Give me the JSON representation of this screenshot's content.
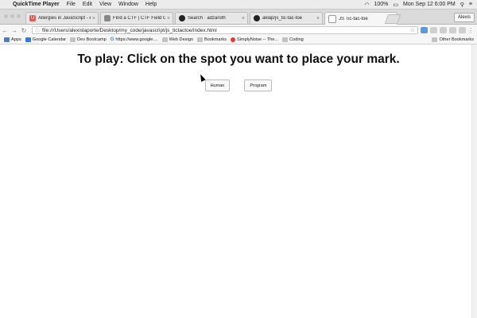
{
  "menubar": {
    "app": "QuickTime Player",
    "items": [
      "File",
      "Edit",
      "View",
      "Window",
      "Help"
    ],
    "battery": "100%",
    "clock": "Mon Sep 12  6:00 PM"
  },
  "tabs": [
    {
      "title": "Allergies in JavaScript - exe",
      "color": "#e05a5a",
      "icon": "U"
    },
    {
      "title": "Find a CTF | CTF Field Guide",
      "color": "#888888",
      "icon": "▤"
    },
    {
      "title": "Search · adzaroth",
      "color": "#222222",
      "icon": "●"
    },
    {
      "title": "aklap/js_tic-tac-toe",
      "color": "#222222",
      "icon": "●"
    },
    {
      "title": "JS Tic-tac-toe",
      "color": "#999999",
      "icon": "▯"
    }
  ],
  "profile": "Alexis",
  "toolbar": {
    "url": "file:///Users/alexislaporte/Desktop/my_code/javascript/js_tictactoe/index.html"
  },
  "bookmarks": [
    {
      "label": "Apps",
      "icon": "grid"
    },
    {
      "label": "Google Calendar",
      "icon": "cal"
    },
    {
      "label": "Dev Bootcamp",
      "icon": "folder"
    },
    {
      "label": "https://www.google....",
      "icon": "g"
    },
    {
      "label": "Web Design",
      "icon": "folder"
    },
    {
      "label": "Bookmarks",
      "icon": "folder"
    },
    {
      "label": "SimplyNoise -- The...",
      "icon": "sn"
    },
    {
      "label": "Coding",
      "icon": "folder"
    }
  ],
  "other_bookmarks": "Other Bookmarks",
  "page": {
    "heading": "To play: Click on the spot you want to place your mark.",
    "human_button": "Human",
    "program_button": "Program"
  }
}
